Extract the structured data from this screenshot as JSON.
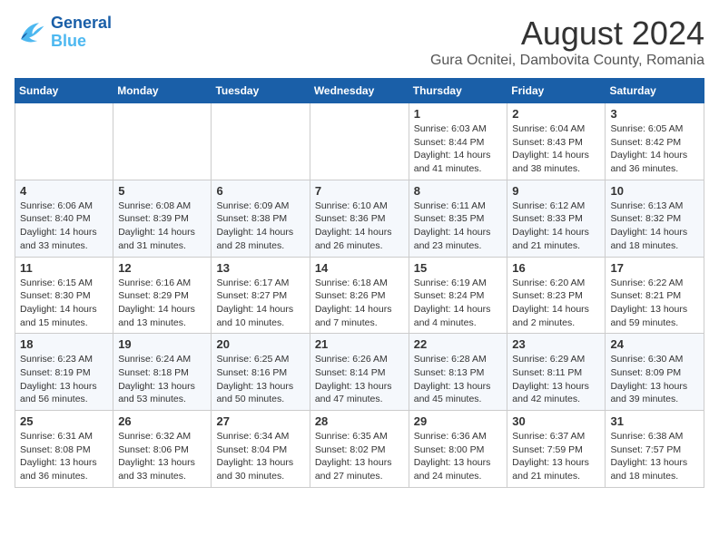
{
  "header": {
    "logo_line1": "General",
    "logo_line2": "Blue",
    "title": "August 2024",
    "subtitle": "Gura Ocnitei, Dambovita County, Romania"
  },
  "weekdays": [
    "Sunday",
    "Monday",
    "Tuesday",
    "Wednesday",
    "Thursday",
    "Friday",
    "Saturday"
  ],
  "weeks": [
    [
      {
        "day": "",
        "info": ""
      },
      {
        "day": "",
        "info": ""
      },
      {
        "day": "",
        "info": ""
      },
      {
        "day": "",
        "info": ""
      },
      {
        "day": "1",
        "info": "Sunrise: 6:03 AM\nSunset: 8:44 PM\nDaylight: 14 hours\nand 41 minutes."
      },
      {
        "day": "2",
        "info": "Sunrise: 6:04 AM\nSunset: 8:43 PM\nDaylight: 14 hours\nand 38 minutes."
      },
      {
        "day": "3",
        "info": "Sunrise: 6:05 AM\nSunset: 8:42 PM\nDaylight: 14 hours\nand 36 minutes."
      }
    ],
    [
      {
        "day": "4",
        "info": "Sunrise: 6:06 AM\nSunset: 8:40 PM\nDaylight: 14 hours\nand 33 minutes."
      },
      {
        "day": "5",
        "info": "Sunrise: 6:08 AM\nSunset: 8:39 PM\nDaylight: 14 hours\nand 31 minutes."
      },
      {
        "day": "6",
        "info": "Sunrise: 6:09 AM\nSunset: 8:38 PM\nDaylight: 14 hours\nand 28 minutes."
      },
      {
        "day": "7",
        "info": "Sunrise: 6:10 AM\nSunset: 8:36 PM\nDaylight: 14 hours\nand 26 minutes."
      },
      {
        "day": "8",
        "info": "Sunrise: 6:11 AM\nSunset: 8:35 PM\nDaylight: 14 hours\nand 23 minutes."
      },
      {
        "day": "9",
        "info": "Sunrise: 6:12 AM\nSunset: 8:33 PM\nDaylight: 14 hours\nand 21 minutes."
      },
      {
        "day": "10",
        "info": "Sunrise: 6:13 AM\nSunset: 8:32 PM\nDaylight: 14 hours\nand 18 minutes."
      }
    ],
    [
      {
        "day": "11",
        "info": "Sunrise: 6:15 AM\nSunset: 8:30 PM\nDaylight: 14 hours\nand 15 minutes."
      },
      {
        "day": "12",
        "info": "Sunrise: 6:16 AM\nSunset: 8:29 PM\nDaylight: 14 hours\nand 13 minutes."
      },
      {
        "day": "13",
        "info": "Sunrise: 6:17 AM\nSunset: 8:27 PM\nDaylight: 14 hours\nand 10 minutes."
      },
      {
        "day": "14",
        "info": "Sunrise: 6:18 AM\nSunset: 8:26 PM\nDaylight: 14 hours\nand 7 minutes."
      },
      {
        "day": "15",
        "info": "Sunrise: 6:19 AM\nSunset: 8:24 PM\nDaylight: 14 hours\nand 4 minutes."
      },
      {
        "day": "16",
        "info": "Sunrise: 6:20 AM\nSunset: 8:23 PM\nDaylight: 14 hours\nand 2 minutes."
      },
      {
        "day": "17",
        "info": "Sunrise: 6:22 AM\nSunset: 8:21 PM\nDaylight: 13 hours\nand 59 minutes."
      }
    ],
    [
      {
        "day": "18",
        "info": "Sunrise: 6:23 AM\nSunset: 8:19 PM\nDaylight: 13 hours\nand 56 minutes."
      },
      {
        "day": "19",
        "info": "Sunrise: 6:24 AM\nSunset: 8:18 PM\nDaylight: 13 hours\nand 53 minutes."
      },
      {
        "day": "20",
        "info": "Sunrise: 6:25 AM\nSunset: 8:16 PM\nDaylight: 13 hours\nand 50 minutes."
      },
      {
        "day": "21",
        "info": "Sunrise: 6:26 AM\nSunset: 8:14 PM\nDaylight: 13 hours\nand 47 minutes."
      },
      {
        "day": "22",
        "info": "Sunrise: 6:28 AM\nSunset: 8:13 PM\nDaylight: 13 hours\nand 45 minutes."
      },
      {
        "day": "23",
        "info": "Sunrise: 6:29 AM\nSunset: 8:11 PM\nDaylight: 13 hours\nand 42 minutes."
      },
      {
        "day": "24",
        "info": "Sunrise: 6:30 AM\nSunset: 8:09 PM\nDaylight: 13 hours\nand 39 minutes."
      }
    ],
    [
      {
        "day": "25",
        "info": "Sunrise: 6:31 AM\nSunset: 8:08 PM\nDaylight: 13 hours\nand 36 minutes."
      },
      {
        "day": "26",
        "info": "Sunrise: 6:32 AM\nSunset: 8:06 PM\nDaylight: 13 hours\nand 33 minutes."
      },
      {
        "day": "27",
        "info": "Sunrise: 6:34 AM\nSunset: 8:04 PM\nDaylight: 13 hours\nand 30 minutes."
      },
      {
        "day": "28",
        "info": "Sunrise: 6:35 AM\nSunset: 8:02 PM\nDaylight: 13 hours\nand 27 minutes."
      },
      {
        "day": "29",
        "info": "Sunrise: 6:36 AM\nSunset: 8:00 PM\nDaylight: 13 hours\nand 24 minutes."
      },
      {
        "day": "30",
        "info": "Sunrise: 6:37 AM\nSunset: 7:59 PM\nDaylight: 13 hours\nand 21 minutes."
      },
      {
        "day": "31",
        "info": "Sunrise: 6:38 AM\nSunset: 7:57 PM\nDaylight: 13 hours\nand 18 minutes."
      }
    ]
  ]
}
